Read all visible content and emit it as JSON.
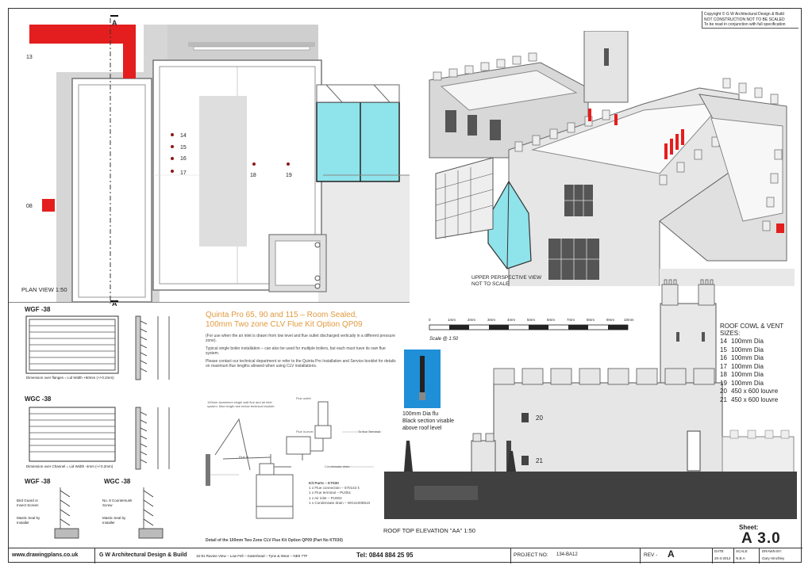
{
  "copyright": {
    "lines": [
      "Copyright © G W Architectural Design & Build",
      "NOT CONSTRUCTION NOT TO BE SCALED",
      "To be read in conjunction with full specification"
    ]
  },
  "plan": {
    "label": "PLAN VIEW 1:50",
    "section_marker": "A",
    "point_labels": [
      "14",
      "15",
      "16",
      "17",
      "18",
      "19"
    ],
    "left_labels": [
      "13",
      "08"
    ]
  },
  "perspective": {
    "label_lines": [
      "UPPER PERSPECTIVE VIEW",
      "NOT TO SCALE"
    ]
  },
  "grilles": {
    "items": [
      {
        "title": "WGF -38",
        "caption": "Dimension over flanges = Lid Width +60mm (+/-0.2mm)"
      },
      {
        "title": "WGC -38",
        "caption": "Dimension over Channel = Lid Width -4mm (+/-0.2mm)"
      }
    ],
    "bottom_titles": [
      "WGF -38",
      "WGC -38"
    ],
    "bottom_notes_left": [
      "Bird Guard or Insect Screen",
      "Mastic Seal by Installer"
    ],
    "bottom_notes_right": [
      "No. 8 Countersunk Screw",
      "Mastic Seal by Installer"
    ]
  },
  "flue": {
    "title_lines": [
      "Quinta Pro 65, 90 and 115 – Room Sealed,",
      "100mm Two zone CLV Flue Kit Option QP09"
    ],
    "paragraphs": [
      "(For use when the air inlet is drawn from low level and flue outlet discharged vertically in a different pressure zone).",
      "Typical single boiler installation – can also be used for multiple boilers, but each must have its own flue system.",
      "Please contact our technical department or refer to the Quinta Pro Installation and Service booklet for details on maximum flue lengths allowed when using CLV installations."
    ],
    "diagram_labels": [
      "100mm aluminium single wall flue and air inlet system. Max length see below technical booklet",
      "Flue outlet",
      "Flue in-level",
      "To flue Terminal",
      "Flue dr. ...",
      "Condensate drain"
    ],
    "kit_title": "Kit Parts – KT030",
    "kit_items": [
      "1 x Flue connection – 570142 ś",
      "1 x Flue terminal – PU051",
      "1 x Air inlet – PU002",
      "1 x Condensate drain – WG41008510"
    ],
    "caption": "Detail of the 100mm Two Zone CLV Flue Kit Option QP09 (Part No KT030)"
  },
  "scale_bar": {
    "ticks": [
      "0",
      "1mm",
      "2mm",
      "3mm",
      "4mm",
      "5mm",
      "6mm",
      "7mm",
      "8mm",
      "9mm",
      "10mm"
    ],
    "label": "Scale @ 1:50"
  },
  "flu_note": {
    "lines": [
      "100mm Dia flu",
      "Black section visable",
      "above roof level"
    ]
  },
  "elevation": {
    "label": "ROOF TOP ELEVATION \"AA\" 1:50",
    "vent_labels": [
      "20",
      "21"
    ]
  },
  "sizes": {
    "title": "ROOF COWL & VENT SIZES:",
    "rows": [
      {
        "num": "14",
        "desc": "100mm Dia"
      },
      {
        "num": "15",
        "desc": "100mm Dia"
      },
      {
        "num": "16",
        "desc": "100mm Dia"
      },
      {
        "num": "17",
        "desc": "100mm Dia"
      },
      {
        "num": "18",
        "desc": "100mm Dia"
      },
      {
        "num": "19",
        "desc": "100mm Dia"
      },
      {
        "num": "20",
        "desc": "450 x 600 louvre"
      },
      {
        "num": "21",
        "desc": "450 x 600 louvre"
      }
    ]
  },
  "sheet": {
    "label": "Sheet:",
    "number": "A 3.0"
  },
  "footer": {
    "website": "www.drawingplans.co.uk",
    "company": "G W Architectural Design & Build",
    "address": "15-91 Ravine View – Low Fell – Gateshead – Tyne & Wear – NE9 7TF",
    "tel": "Tel: 0844 884 25 95",
    "project_label": "PROJECT NO:",
    "project_no": "134-BA12",
    "rev_label": "REV -",
    "rev_value": "A",
    "date_label": "DATE",
    "date_value": "20-3-2012",
    "scale_label": "SCALE",
    "scale_value": "N.B.A",
    "drawn_label": "DRAWN BY:",
    "drawn_value": "Gary Hinchley"
  },
  "colors": {
    "accent_red": "#e41e1e",
    "glass": "#8fe3ea",
    "flue_orange": "#e19a3f",
    "roof_dark": "#404040"
  }
}
